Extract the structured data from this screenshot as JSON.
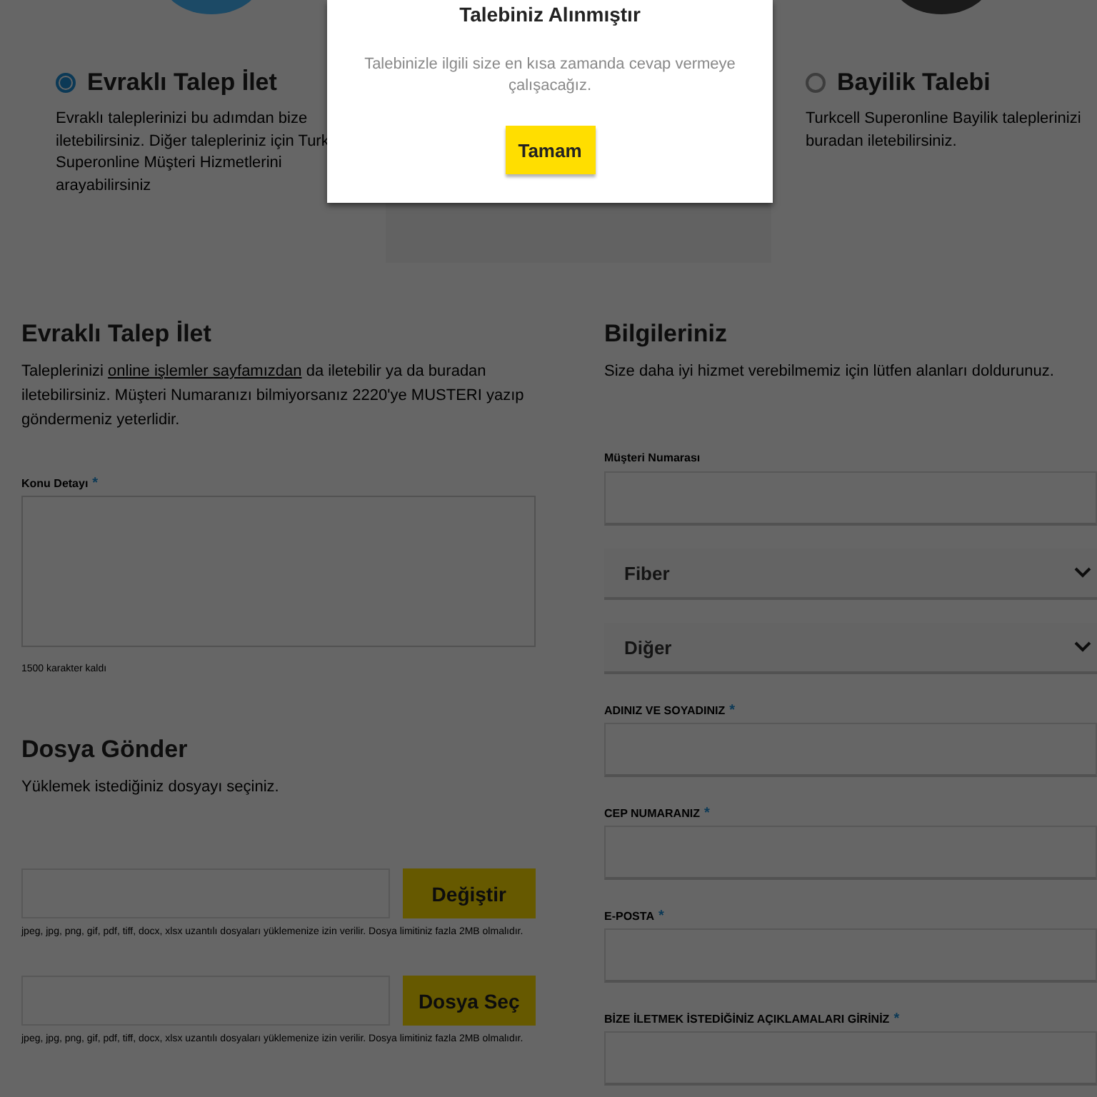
{
  "options": [
    {
      "title": "Evraklı Talep İlet",
      "description": "Evraklı taleplerinizi bu adımdan bize iletebilirsiniz. Diğer talepleriniz için Turk",
      "description_end": "Superonline Müşteri Hizmetlerini arayabilirsiniz",
      "selected": true,
      "color": "#1c4a66"
    },
    {
      "title": "Bayilik Talebi",
      "description": "Turkcell Superonline Bayilik taleplerinizi buradan iletebilirsiniz.",
      "selected": false,
      "color": "#1a1a1a"
    }
  ],
  "request_section": {
    "title": "Evraklı Talep İlet",
    "text_before": "Taleplerinizi ",
    "link": "online işlemler sayfamızdan",
    "text_after": " da iletebilir ya da buradan iletebilirsiniz. Müşteri Numaranızı bilmiyorsanız 2220'ye MUSTERI yazıp göndermeniz yeterlidir.",
    "field_label": "Konu Detayı",
    "mark": "*",
    "counter": "1500 karakter kaldı"
  },
  "upload_section": {
    "title": "Dosya Gönder",
    "subtitle": "Yüklemek istediğiniz dosyayı seçiniz.",
    "files": [
      {
        "button": "Değiştir",
        "hint": "jpeg, jpg, png, gif, pdf, tiff, docx, xlsx uzantılı dosyaları yüklemenize izin verilir. Dosya limitiniz fazla 2MB olmalıdır."
      },
      {
        "button": "Dosya Seç",
        "hint": "jpeg, jpg, png, gif, pdf, tiff, docx, xlsx uzantılı dosyaları yüklemenize izin verilir. Dosya limitiniz fazla 2MB olmalıdır."
      }
    ]
  },
  "info_section": {
    "title": "Bilgileriniz",
    "description": "Size daha iyi hizmet verebilmemiz için lütfen alanları doldurunuz.",
    "fields": [
      {
        "kind": "input",
        "label": "Müşteri Numarası"
      },
      {
        "kind": "select",
        "value": "Fiber"
      },
      {
        "kind": "select",
        "value": "Diğer"
      },
      {
        "kind": "input",
        "label": "ADINIZ VE SOYADINIZ",
        "mark": "*"
      },
      {
        "kind": "input",
        "label": "CEP NUMARANIZ",
        "mark": "*"
      },
      {
        "kind": "input",
        "label": "E-POSTA",
        "mark": "*"
      },
      {
        "kind": "input",
        "label": "BİZE İLETMEK İSTEDİĞİNİZ AÇIKLAMALARI GİRİNİZ",
        "mark": "*"
      }
    ]
  },
  "modal": {
    "title": "Talebiniz Alınmıştır",
    "message": "Talebinizle ilgili size en kısa zamanda cevap vermeye çalışacağız.",
    "button": "Tamam"
  }
}
